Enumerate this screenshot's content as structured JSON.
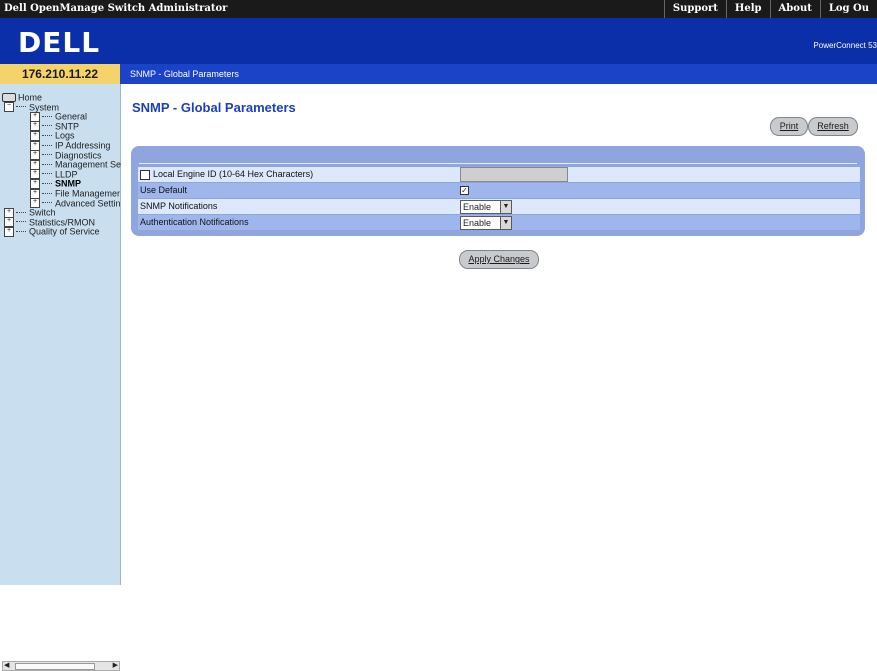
{
  "app": {
    "title": "Dell OpenManage Switch Administrator",
    "top_nav": [
      "Support",
      "Help",
      "About",
      "Log Ou"
    ]
  },
  "header": {
    "logo": "DELL",
    "product": "PowerConnect 53"
  },
  "device": {
    "ip": "176.210.11.22"
  },
  "breadcrumb": "SNMP - Global Parameters",
  "tree": {
    "items": [
      {
        "label": "Home",
        "level": 0,
        "expander": "",
        "icon": "home-icon"
      },
      {
        "label": "System",
        "level": 1,
        "expander": "−"
      },
      {
        "label": "General",
        "level": 2,
        "expander": "+"
      },
      {
        "label": "SNTP",
        "level": 2,
        "expander": "+"
      },
      {
        "label": "Logs",
        "level": 2,
        "expander": "+"
      },
      {
        "label": "IP Addressing",
        "level": 2,
        "expander": "+"
      },
      {
        "label": "Diagnostics",
        "level": 2,
        "expander": "+"
      },
      {
        "label": "Management Se",
        "level": 2,
        "expander": "+"
      },
      {
        "label": "LLDP",
        "level": 2,
        "expander": "+"
      },
      {
        "label": "SNMP",
        "level": 2,
        "expander": "+",
        "selected": true
      },
      {
        "label": "File Managemer",
        "level": 2,
        "expander": "+"
      },
      {
        "label": "Advanced Settin",
        "level": 2,
        "expander": "+"
      },
      {
        "label": "Switch",
        "level": 1,
        "expander": "+"
      },
      {
        "label": "Statistics/RMON",
        "level": 1,
        "expander": "+"
      },
      {
        "label": "Quality of Service",
        "level": 1,
        "expander": "+"
      }
    ]
  },
  "page": {
    "title": "SNMP - Global Parameters",
    "buttons": {
      "print": "Print",
      "refresh": "Refresh",
      "apply": "Apply Changes"
    },
    "fields": {
      "local_engine_id": {
        "label": "Local Engine ID (10-64 Hex Characters)",
        "checked": false,
        "value": ""
      },
      "use_default": {
        "label": "Use Default",
        "checked": true
      },
      "snmp_notifications": {
        "label": "SNMP Notifications",
        "value": "Enable"
      },
      "authentication_notifications": {
        "label": "Authentication Notifications",
        "value": "Enable"
      }
    }
  },
  "colors": {
    "header_blue": "#0b2fa8",
    "ip_yellow": "#f3d36a",
    "tree_bg": "#c9dfef",
    "title_blue": "#1b3fbf",
    "panel_blue": "#8fa5de"
  }
}
